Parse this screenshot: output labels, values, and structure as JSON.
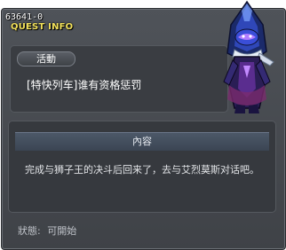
{
  "window": {
    "quest_id": "63641-0",
    "title": "QUEST INFO"
  },
  "quest": {
    "badge_label": "活動",
    "name": "[特快列车]谁有资格惩罚"
  },
  "content": {
    "header": "內容",
    "text": "完成与狮子王的决斗后回来了，去与艾烈莫斯对话吧。"
  },
  "status": {
    "label": "狀態:",
    "value": "可開始"
  },
  "colors": {
    "title": "#f2e15a",
    "panel": "#3a3d42",
    "header_bar": "#4c5868"
  },
  "portrait": {
    "icon": "dark-knight-character-portrait"
  }
}
